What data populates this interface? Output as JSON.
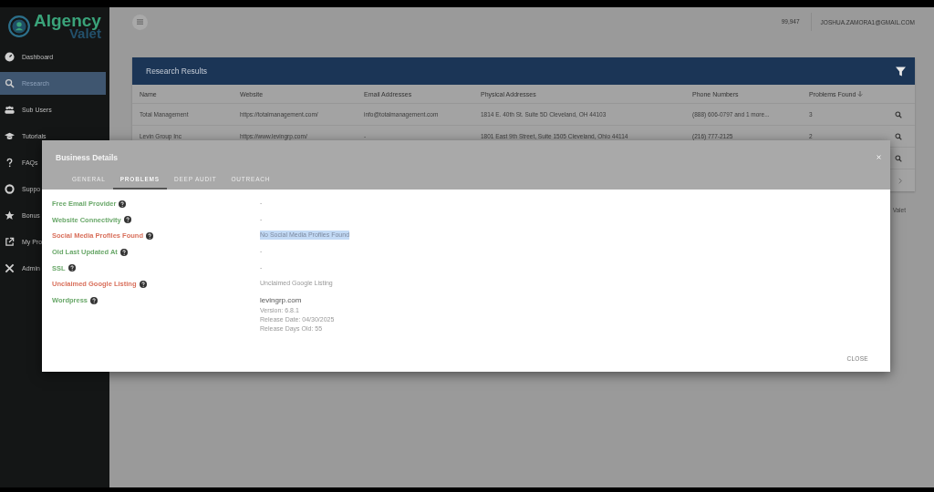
{
  "sidebar": {
    "logo": {
      "word_1": "Algency",
      "word_2": "Valet"
    },
    "items": [
      {
        "label": "Dashboard",
        "selected": false
      },
      {
        "label": "Research",
        "selected": true
      },
      {
        "label": "Sub Users",
        "selected": false
      },
      {
        "label": "Tutorials",
        "selected": false
      },
      {
        "label": "FAQs",
        "selected": false
      },
      {
        "label": "Suppo",
        "selected": false
      },
      {
        "label": "Bonus",
        "selected": false
      },
      {
        "label": "My Pro",
        "selected": false
      },
      {
        "label": "Admin",
        "selected": false
      }
    ]
  },
  "topbar": {
    "credits": "99,947",
    "user": "JOSHUA.ZAMORA1@GMAIL.COM"
  },
  "table": {
    "title": "Research Results",
    "columns": [
      "Name",
      "Website",
      "Email Addresses",
      "Physical Addresses",
      "Phone Numbers",
      "Problems Found"
    ],
    "rows": [
      [
        "Total Management",
        "https://totalmanagement.com/",
        "info@totalmanagement.com",
        "1814 E. 40th St. Suite 5D Cleveland, OH 44103",
        "(888) 606-0797 and 1 more...",
        "3"
      ],
      [
        "Levin Group Inc",
        "https://www.levingrp.com/",
        "-",
        "1801 East 9th Street, Suite 1505 Cleveland, Ohio 44114",
        "(216) 777-2125",
        "2"
      ]
    ]
  },
  "footer_text": "Valet",
  "modal": {
    "title": "Business Details",
    "tabs": [
      {
        "label": "GENERAL",
        "selected": false
      },
      {
        "label": "PROBLEMS",
        "selected": true
      },
      {
        "label": "DEEP AUDIT",
        "selected": false
      },
      {
        "label": "OUTREACH",
        "selected": false
      }
    ],
    "problems": [
      {
        "label": "Free Email Provider",
        "color": "#6aa86a",
        "highlighted": false,
        "value": [
          "-"
        ]
      },
      {
        "label": "Website Connectivity",
        "color": "#6aa86a",
        "highlighted": false,
        "value": [
          "-"
        ]
      },
      {
        "label": "Social Media Profiles Found",
        "color": "#d9705c",
        "highlighted": true,
        "value": [
          "No Social Media Profiles Found"
        ]
      },
      {
        "label": "Old Last Updated At",
        "color": "#6aa86a",
        "highlighted": false,
        "value": [
          "-"
        ]
      },
      {
        "label": "SSL",
        "color": "#6aa86a",
        "highlighted": false,
        "value": [
          "-"
        ]
      },
      {
        "label": "Unclaimed Google Listing",
        "color": "#d9705c",
        "highlighted": false,
        "value": [
          "Unclaimed Google Listing"
        ]
      },
      {
        "label": "Wordpress",
        "color": "#6aa86a",
        "highlighted": false,
        "value": [
          "levingrp.com",
          "Version: 6.8.1",
          "Release Date: 04/30/2025",
          "Release Days Old: 55"
        ]
      }
    ],
    "close_button": "CLOSE"
  }
}
